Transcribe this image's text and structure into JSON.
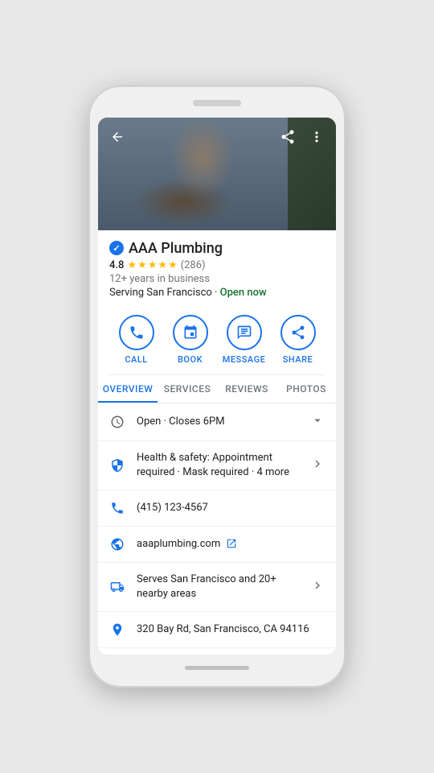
{
  "phone": {
    "speaker_label": "speaker"
  },
  "header": {
    "back_label": "back",
    "share_label": "share",
    "more_label": "more options"
  },
  "business": {
    "name": "AAA Plumbing",
    "verified": true,
    "rating": "4.8",
    "review_count": "(286)",
    "years": "12+ years in business",
    "location": "Serving San Francisco",
    "status": "Open now"
  },
  "actions": [
    {
      "id": "call",
      "label": "CALL",
      "icon": "phone-icon"
    },
    {
      "id": "book",
      "label": "BOOK",
      "icon": "calendar-icon"
    },
    {
      "id": "message",
      "label": "MESSAGE",
      "icon": "message-icon"
    },
    {
      "id": "share",
      "label": "SHARE",
      "icon": "share-icon"
    }
  ],
  "tabs": [
    {
      "id": "overview",
      "label": "OVERVIEW",
      "active": true
    },
    {
      "id": "services",
      "label": "SERVICES",
      "active": false
    },
    {
      "id": "reviews",
      "label": "REVIEWS",
      "active": false
    },
    {
      "id": "photos",
      "label": "PHOTOS",
      "active": false
    }
  ],
  "info_rows": [
    {
      "id": "hours",
      "icon": "clock-icon",
      "text": "Open · Closes 6PM",
      "has_chevron": true,
      "chevron_type": "down"
    },
    {
      "id": "health",
      "icon": "shield-icon",
      "text": "Health & safety: Appointment required · Mask required · 4 more",
      "has_chevron": true,
      "chevron_type": "right"
    },
    {
      "id": "phone",
      "icon": "phone-icon",
      "text": "(415) 123-4567",
      "has_chevron": false
    },
    {
      "id": "website",
      "icon": "globe-icon",
      "text": "aaaplumbing.com",
      "has_chevron": false,
      "has_external": true
    },
    {
      "id": "service-area",
      "icon": "truck-icon",
      "text": "Serves San Francisco and 20+ nearby areas",
      "has_chevron": true,
      "chevron_type": "right"
    },
    {
      "id": "address",
      "icon": "pin-icon",
      "text": "320 Bay Rd, San Francisco, CA 94116",
      "has_chevron": false
    }
  ]
}
